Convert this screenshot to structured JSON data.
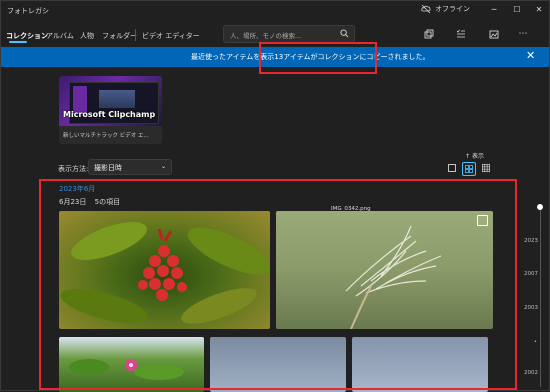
{
  "app": {
    "title": "フォトレガシ",
    "offline": "オフライン"
  },
  "nav": {
    "items": [
      "コレクション",
      "アルバム",
      "人物",
      "フォルダー",
      "ビデオ エディター"
    ]
  },
  "search": {
    "placeholder": "人、場所、モノの検索..."
  },
  "banner": {
    "prefix": "最近使ったアイテムを表示",
    "highlight": "13アイテムがコレクションにコピーされました。"
  },
  "card": {
    "title": "Microsoft Clipchamp",
    "subtitle": "新しいマルチトラック ビデオ エ..."
  },
  "sort": {
    "label": "表示方法:",
    "value": "撮影日時"
  },
  "view": {
    "tooltip": "表示"
  },
  "gallery": {
    "month": "2023年6月",
    "day": "6月23日",
    "count": "5の項目",
    "hover_file": "IMG_0342.png"
  },
  "timeline": {
    "years": [
      "2023",
      "2007",
      "2003",
      "2002"
    ]
  },
  "colors": {
    "accent": "#0067b8",
    "highlight_box": "#e8282e",
    "link": "#3a8ad6"
  }
}
